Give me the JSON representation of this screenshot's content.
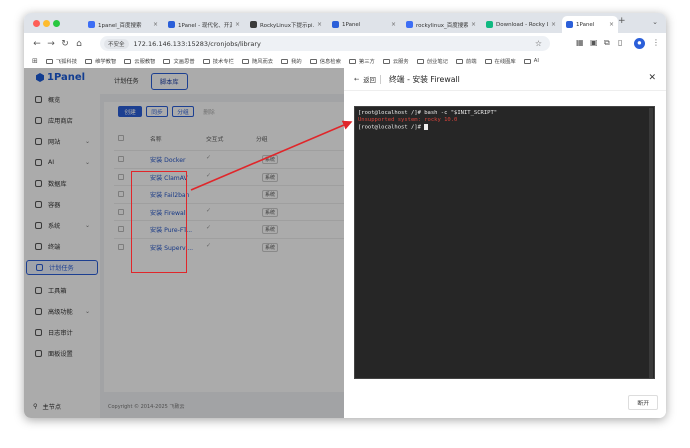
{
  "browser": {
    "tabs": [
      {
        "title": "1panel_百度搜索",
        "color": "#3d6ef5",
        "active": false
      },
      {
        "title": "1Panel - 现代化、开源...",
        "color": "#2b5fd9",
        "active": false
      },
      {
        "title": "RockyLinux下提示pi...",
        "color": "#3b3b3b",
        "active": false
      },
      {
        "title": "1Panel",
        "color": "#2b5fd9",
        "active": false
      },
      {
        "title": "rockylinux_百度搜索",
        "color": "#3d6ef5",
        "active": false
      },
      {
        "title": "Download - Rocky Lin...",
        "color": "#10b981",
        "active": false
      },
      {
        "title": "1Panel",
        "color": "#2b5fd9",
        "active": true
      }
    ],
    "new_tab": "+",
    "insecure_label": "不安全",
    "url": "172.16.146.133:15283/cronjobs/library",
    "bookmarks": [
      "飞狐科技",
      "维学教智",
      "云服教智",
      "文画思普",
      "技术专栏",
      "随风而去",
      "我的",
      "信息检索",
      "第三方",
      "云服务",
      "创业笔记",
      "前端",
      "在线图库",
      "AI"
    ]
  },
  "sidebar": {
    "brand": "1Panel",
    "items": [
      {
        "label": "概览",
        "chevron": false
      },
      {
        "label": "应用商店",
        "chevron": false
      },
      {
        "label": "网站",
        "chevron": true
      },
      {
        "label": "AI",
        "chevron": true
      },
      {
        "label": "数据库",
        "chevron": false
      },
      {
        "label": "容器",
        "chevron": false
      },
      {
        "label": "系统",
        "chevron": true
      },
      {
        "label": "终端",
        "chevron": false
      },
      {
        "label": "计划任务",
        "chevron": false,
        "active": true
      },
      {
        "label": "工具箱",
        "chevron": false
      },
      {
        "label": "高级功能",
        "chevron": true
      },
      {
        "label": "日志审计",
        "chevron": false
      },
      {
        "label": "面板设置",
        "chevron": false
      }
    ],
    "node": "主节点"
  },
  "page": {
    "tab_cron": "计划任务",
    "tab_library": "脚本库",
    "buttons": {
      "create": "创建",
      "sync": "同步",
      "group": "分组",
      "delete": "删除"
    },
    "columns": {
      "name": "名称",
      "interactive": "交互式",
      "group": "分组"
    },
    "rows": [
      {
        "name": "安装 Docker",
        "interactive": "✓",
        "group": "系统"
      },
      {
        "name": "安装 ClamAV",
        "interactive": "✓",
        "group": "系统"
      },
      {
        "name": "安装 Fail2ban",
        "interactive": "",
        "group": "系统"
      },
      {
        "name": "安装 Firewall",
        "interactive": "✓",
        "group": "系统"
      },
      {
        "name": "安装 Pure-FT...",
        "interactive": "✓",
        "group": "系统"
      },
      {
        "name": "安装 Supervi...",
        "interactive": "✓",
        "group": "系统"
      }
    ],
    "copyright": "Copyright © 2014-2025 飞致云"
  },
  "drawer": {
    "back": "返回",
    "title": "终端 - 安装 Firewall",
    "terminal_lines": [
      {
        "text": "[root@localhost /]# bash -c \"$INIT_SCRIPT\"",
        "error": false
      },
      {
        "text": "Unsupported system: rocky 10.0",
        "error": true
      },
      {
        "text": "[root@localhost /]# ",
        "error": false
      }
    ],
    "disconnect": "断开"
  },
  "colors": {
    "accent": "#2b5fd9",
    "annotation": "#e0262a",
    "terminal_bg": "#262626"
  }
}
